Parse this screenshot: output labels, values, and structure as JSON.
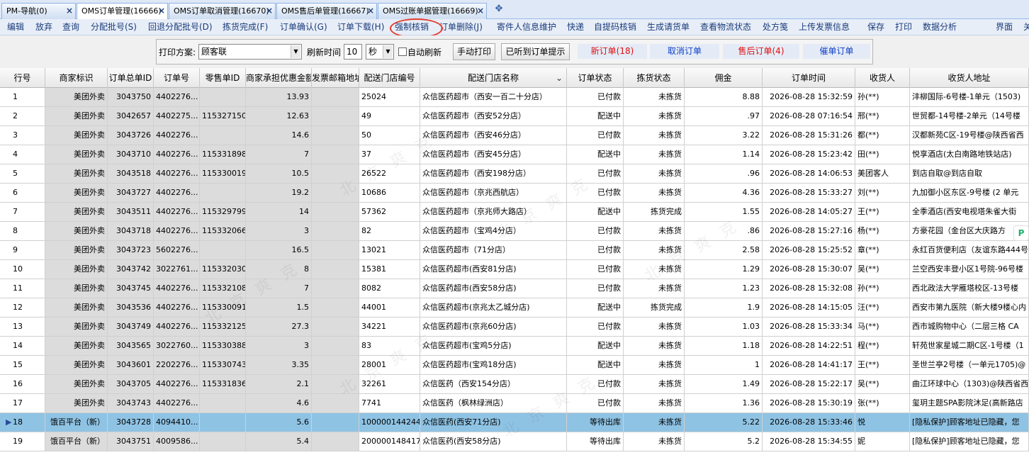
{
  "tabs": [
    {
      "label": "PM-导航(0)",
      "close": "×"
    },
    {
      "label": "OMS订单管理(16666)",
      "close": "×"
    },
    {
      "label": "OMS订单取消管理(16670)",
      "close": "×"
    },
    {
      "label": "OMS售后单管理(16667)",
      "close": "×"
    },
    {
      "label": "OMS过账单据管理(16669)",
      "close": "×"
    }
  ],
  "tab_add": "✥",
  "menu": [
    "编辑",
    "放弃",
    "查询",
    "分配批号(S)",
    "回退分配批号(D)",
    "拣货完成(F)",
    "订单确认(G)",
    "订单下载(H)",
    "强制核销",
    "订单删除(J)",
    "寄件人信息维护",
    "快递",
    "自提码核销",
    "生成请货单",
    "查看物流状态",
    "处方笺",
    "上传发票信息",
    "保存",
    "打印",
    "数据分析",
    "界面",
    "关"
  ],
  "toolbar": {
    "print_plan_label": "打印方案:",
    "print_plan_value": "顾客联",
    "refresh_label": "刷新时间",
    "refresh_value": "10",
    "unit_value": "秒",
    "auto_refresh_label": "自动刷新",
    "manual_print": "手动打印",
    "heard_prompt": "已听到订单提示",
    "new_order": "新订单(18)",
    "cancel_order": "取消订单",
    "after_sale": "售后订单(4)",
    "urge_order": "催单订单"
  },
  "colors": {
    "alert_red": "#e01010",
    "link_blue": "#1040c8",
    "selected_row": "#8fc3e4"
  },
  "icons": {
    "dropdown": "▼",
    "sort": "⌄",
    "row_pointer": "▶",
    "side_badge": "P"
  },
  "watermark": "北 京 爽 克",
  "grid": {
    "headers": [
      "行号",
      "商家标识",
      "订单总单ID",
      "订单号",
      "零售单ID",
      "商家承担优惠金额",
      "发票邮箱地址",
      "配送门店编号",
      "配送门店名称",
      "订单状态",
      "拣货状态",
      "佣金",
      "订单时间",
      "收货人",
      "收货人地址"
    ],
    "rows": [
      [
        "1",
        "美团外卖",
        "3043750",
        "4402276...",
        "",
        "13.93",
        "",
        "25024",
        "众信医药超市（西安一百二十分店）",
        "已付款",
        "未拣货",
        "8.88",
        "2026-08-28 15:32:59",
        "孙(**)",
        "沣柳国际-6号楼-1单元（1503)"
      ],
      [
        "2",
        "美团外卖",
        "3042657",
        "4402275...",
        "115327150",
        "12.63",
        "",
        "49",
        "众信医药超市（西安52分店）",
        "配送中",
        "未拣货",
        ".97",
        "2026-08-28 07:16:54",
        "邢(**)",
        "世贸都-14号楼-2单元（14号楼"
      ],
      [
        "3",
        "美团外卖",
        "3043726",
        "4402276...",
        "",
        "14.6",
        "",
        "50",
        "众信医药超市（西安46分店）",
        "已付款",
        "未拣货",
        "3.22",
        "2026-08-28 15:31:26",
        "都(**)",
        "汉都新苑C区-19号楼@陕西省西"
      ],
      [
        "4",
        "美团外卖",
        "3043710",
        "4402276...",
        "115331898",
        "7",
        "",
        "37",
        "众信医药超市（西安45分店）",
        "配送中",
        "未拣货",
        "1.14",
        "2026-08-28 15:23:42",
        "田(**)",
        "悦享酒店(太白南路地铁站店)"
      ],
      [
        "5",
        "美团外卖",
        "3043518",
        "4402276...",
        "115330019",
        "10.5",
        "",
        "26522",
        "众信医药超市（西安198分店）",
        "已付款",
        "未拣货",
        ".96",
        "2026-08-28 14:06:53",
        "美团客人",
        "到店自取@到店自取"
      ],
      [
        "6",
        "美团外卖",
        "3043727",
        "4402276...",
        "",
        "19.2",
        "",
        "10686",
        "众信医药超市（京兆西航店）",
        "已付款",
        "未拣货",
        "4.36",
        "2026-08-28 15:33:27",
        "刘(**)",
        "九加御小区东区-9号楼 (2 单元"
      ],
      [
        "7",
        "美团外卖",
        "3043511",
        "4402276...",
        "115329799",
        "14",
        "",
        "57362",
        "众信医药超市（京兆师大路店）",
        "配送中",
        "拣货完成",
        "1.55",
        "2026-08-28 14:05:27",
        "王(**)",
        "全季酒店(西安电视塔朱雀大街"
      ],
      [
        "8",
        "美团外卖",
        "3043718",
        "4402276...",
        "115332066",
        "3",
        "",
        "82",
        "众信医药超市（宝鸡4分店）",
        "已付款",
        "未拣货",
        ".86",
        "2026-08-28 15:27:16",
        "杨(**)",
        "方豪花园（金台区大庆路方"
      ],
      [
        "9",
        "美团外卖",
        "3043723",
        "5602276...",
        "",
        "16.5",
        "",
        "13021",
        "众信医药超市（71分店）",
        "已付款",
        "未拣货",
        "2.58",
        "2026-08-28 15:25:52",
        "章(**)",
        "永红百货便利店（友谊东路444号"
      ],
      [
        "10",
        "美团外卖",
        "3043742",
        "3022761...",
        "115332030",
        "8",
        "",
        "15381",
        "众信医药超市(西安81分店)",
        "已付款",
        "未拣货",
        "1.29",
        "2026-08-28 15:30:07",
        "吴(**)",
        "兰空西安丰登小区1号院-96号楼"
      ],
      [
        "11",
        "美团外卖",
        "3043745",
        "4402276...",
        "115332108",
        "7",
        "",
        "8082",
        "众信医药超市(西安58分店)",
        "已付款",
        "未拣货",
        "1.23",
        "2026-08-28 15:32:08",
        "孙(**)",
        "西北政法大学雁塔校区-13号楼"
      ],
      [
        "12",
        "美团外卖",
        "3043536",
        "4402276...",
        "115330091",
        "1.5",
        "",
        "44001",
        "众信医药超市(京兆太乙城分店)",
        "配送中",
        "拣货完成",
        "1.9",
        "2026-08-28 14:15:05",
        "汪(**)",
        "西安市第九医院（新大楼9楼心内"
      ],
      [
        "13",
        "美团外卖",
        "3043749",
        "4402276...",
        "115332125",
        "27.3",
        "",
        "34221",
        "众信医药超市(京兆60分店)",
        "已付款",
        "未拣货",
        "1.03",
        "2026-08-28 15:33:34",
        "马(**)",
        "西市城购物中心（二层三格 CA"
      ],
      [
        "14",
        "美团外卖",
        "3043565",
        "3022760...",
        "115330388",
        "3",
        "",
        "83",
        "众信医药超市(宝鸡5分店)",
        "配送中",
        "未拣货",
        "1.18",
        "2026-08-28 14:22:51",
        "程(**)",
        "轩苑世家星城二期C区-1号楼（1"
      ],
      [
        "15",
        "美团外卖",
        "3043601",
        "2202276...",
        "115330743",
        "3.35",
        "",
        "28001",
        "众信医药超市(宝鸡18分店)",
        "配送中",
        "未拣货",
        "1",
        "2026-08-28 14:41:17",
        "王(**)",
        "圣世兰亭2号楼（一单元1705)@"
      ],
      [
        "16",
        "美团外卖",
        "3043705",
        "4402276...",
        "115331836",
        "2.1",
        "",
        "32261",
        "众信医药（西安154分店）",
        "已付款",
        "未拣货",
        "1.49",
        "2026-08-28 15:22:17",
        "吴(**)",
        "曲江环球中心（1303)@陕西省西"
      ],
      [
        "17",
        "美团外卖",
        "3043743",
        "4402276...",
        "",
        "4.6",
        "",
        "7741",
        "众信医药（枫林绿洲店）",
        "已付款",
        "未拣货",
        "1.36",
        "2026-08-28 15:30:19",
        "张(**)",
        "玺玥主题SPA影院沐足(高新路店"
      ],
      [
        "18",
        "饿百平台（新）",
        "3043728",
        "4094410...",
        "",
        "5.6",
        "",
        "100000144244",
        "众信医药(西安71分店)",
        "等待出库",
        "未拣货",
        "5.22",
        "2026-08-28 15:33:46",
        "悦",
        "[隐私保护]顾客地址已隐藏，您"
      ],
      [
        "19",
        "饿百平台（新）",
        "3043751",
        "4009586...",
        "",
        "5.4",
        "",
        "200000148417",
        "众信医药(西安58分店)",
        "等待出库",
        "未拣货",
        "5.2",
        "2026-08-28 15:34:55",
        "妮",
        "[隐私保护]顾客地址已隐藏，您"
      ]
    ]
  }
}
